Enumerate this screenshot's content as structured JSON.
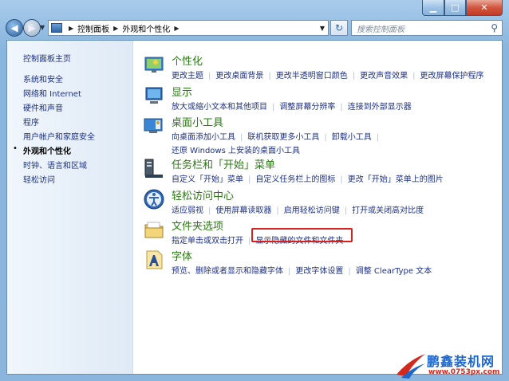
{
  "window": {
    "caption_buttons": {
      "minimize_icon": "minimize-icon",
      "maximize_icon": "maximize-icon",
      "close_icon": "close-icon"
    }
  },
  "address_bar": {
    "root": "控制面板",
    "current": "外观和个性化",
    "search_placeholder": "搜索控制面板"
  },
  "sidebar": {
    "home": "控制面板主页",
    "items": [
      {
        "label": "系统和安全"
      },
      {
        "label": "网络和 Internet"
      },
      {
        "label": "硬件和声音"
      },
      {
        "label": "程序"
      },
      {
        "label": "用户帐户和家庭安全"
      },
      {
        "label": "外观和个性化",
        "active": true
      },
      {
        "label": "时钟、语言和区域"
      },
      {
        "label": "轻松访问"
      }
    ]
  },
  "categories": [
    {
      "title": "个性化",
      "icon": "personalization-icon",
      "links": [
        "更改主题",
        "更改桌面背景",
        "更改半透明窗口颜色",
        "更改声音效果",
        "更改屏幕保护程序"
      ]
    },
    {
      "title": "显示",
      "icon": "display-icon",
      "links": [
        "放大或缩小文本和其他项目",
        "调整屏幕分辨率",
        "连接到外部显示器"
      ]
    },
    {
      "title": "桌面小工具",
      "icon": "gadgets-icon",
      "links": [
        "向桌面添加小工具",
        "联机获取更多小工具",
        "卸载小工具"
      ],
      "links2": [
        "还原 Windows 上安装的桌面小工具"
      ]
    },
    {
      "title": "任务栏和「开始」菜单",
      "icon": "taskbar-icon",
      "links": [
        "自定义「开始」菜单",
        "自定义任务栏上的图标",
        "更改「开始」菜单上的图片"
      ]
    },
    {
      "title": "轻松访问中心",
      "icon": "ease-of-access-icon",
      "links": [
        "适应弱视",
        "使用屏幕读取器",
        "启用轻松访问键",
        "打开或关闭高对比度"
      ]
    },
    {
      "title": "文件夹选项",
      "icon": "folder-options-icon",
      "links": [
        "指定单击或双击打开",
        "显示隐藏的文件和文件夹"
      ]
    },
    {
      "title": "字体",
      "icon": "fonts-icon",
      "links": [
        "预览、删除或者显示和隐藏字体",
        "更改字体设置",
        "调整 ClearType 文本"
      ]
    }
  ],
  "watermark": {
    "big": "鹏鑫装机网",
    "small": "www.0753px.com"
  },
  "colors": {
    "title_green": "#2a7a12",
    "link_blue": "#1e3287",
    "highlight_red": "#d8211c"
  }
}
